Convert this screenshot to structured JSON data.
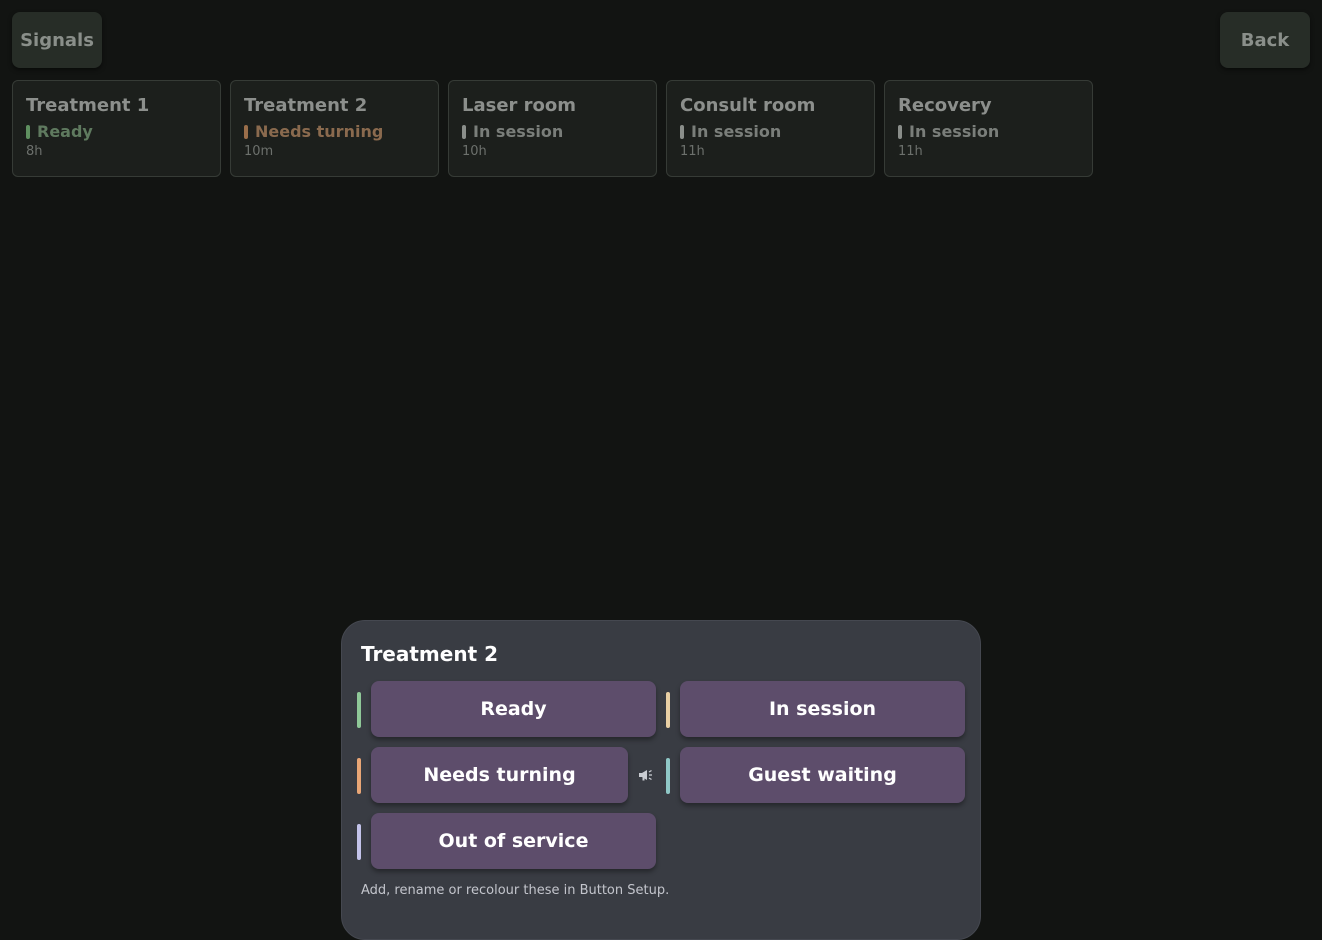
{
  "header": {
    "signals_label": "Signals",
    "back_label": "Back"
  },
  "rooms": [
    {
      "name": "Treatment 1",
      "status": "Ready",
      "time": "8h",
      "status_color": "#5f7a5f",
      "bar_color": "#5f9060"
    },
    {
      "name": "Treatment 2",
      "status": "Needs turning",
      "time": "10m",
      "status_color": "#8a6a4e",
      "bar_color": "#9a6e4a"
    },
    {
      "name": "Laser room",
      "status": "In session",
      "time": "10h",
      "status_color": "#7a7e7a",
      "bar_color": "#8a8e8a"
    },
    {
      "name": "Consult room",
      "status": "In session",
      "time": "11h",
      "status_color": "#7a7e7a",
      "bar_color": "#8a8e8a"
    },
    {
      "name": "Recovery",
      "status": "In session",
      "time": "11h",
      "status_color": "#7a7e7a",
      "bar_color": "#8a8e8a"
    }
  ],
  "panel": {
    "title": "Treatment 2",
    "options": [
      {
        "label": "Ready",
        "color": "#8fc898"
      },
      {
        "label": "In session",
        "color": "#e8cfa4"
      },
      {
        "label": "Needs turning",
        "color": "#e9a676"
      },
      {
        "label": "Guest waiting",
        "color": "#8fc7c6"
      },
      {
        "label": "Out of service",
        "color": "#c3c3ea"
      }
    ],
    "hint": "Add, rename or recolour these in Button Setup.",
    "announce_icon": "megaphone-icon"
  }
}
